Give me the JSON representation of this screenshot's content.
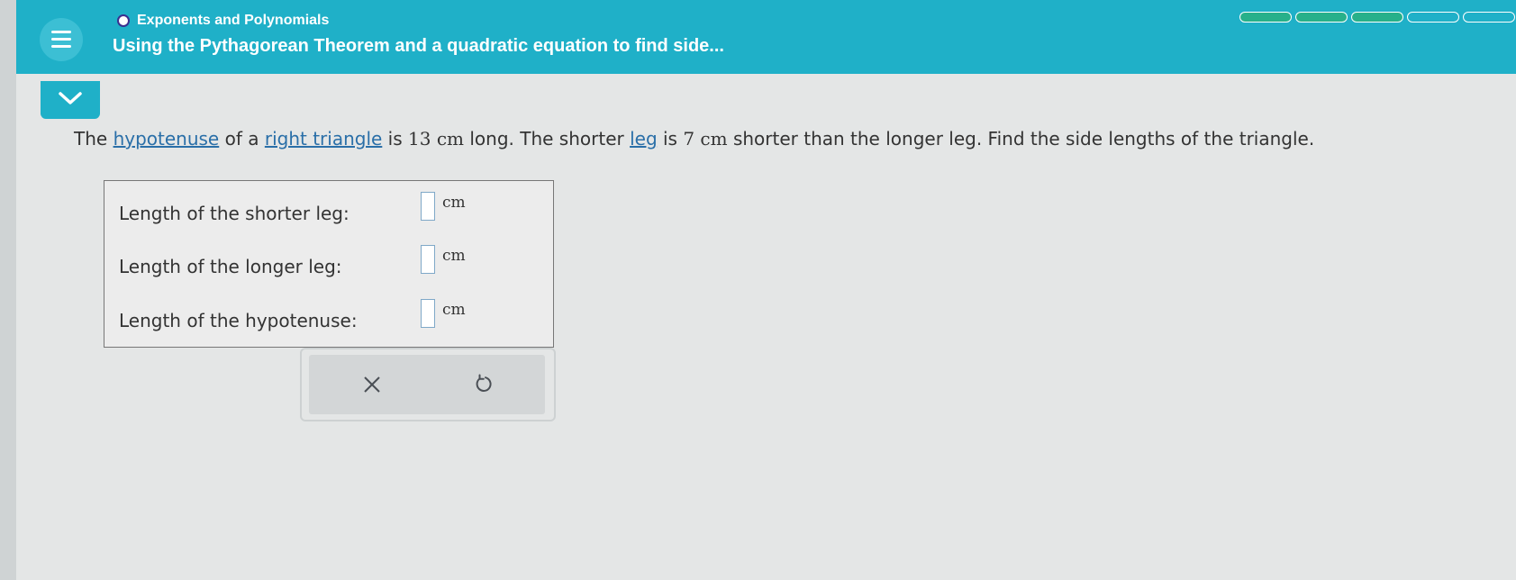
{
  "header": {
    "breadcrumb": "Exponents and Polynomials",
    "title": "Using the Pythagorean Theorem and a quadratic equation to find side...",
    "menu_icon": "hamburger-menu-icon",
    "progress": {
      "filled": 3,
      "total": 5,
      "filled_color": "#27b08a"
    }
  },
  "collapse_icon": "chevron-down-icon",
  "question": {
    "p1": "The ",
    "link1": "hypotenuse",
    "p2": " of a ",
    "link2": "right triangle",
    "p3": " is ",
    "m1": "13 cm",
    "p4": " long. The shorter ",
    "link3": "leg",
    "p5": " is ",
    "m2": "7 cm",
    "p6": " shorter than the longer leg. Find the side lengths of the triangle."
  },
  "answers": [
    {
      "label": "Length of the shorter leg:",
      "value": "",
      "unit": "cm"
    },
    {
      "label": "Length of the longer leg:",
      "value": "",
      "unit": "cm"
    },
    {
      "label": "Length of the hypotenuse:",
      "value": "",
      "unit": "cm"
    }
  ],
  "tools": {
    "clear_icon": "x-icon",
    "undo_icon": "undo-icon"
  },
  "colors": {
    "header": "#1fb0c8",
    "link": "#2a6fa8",
    "background": "#e4e6e6"
  }
}
